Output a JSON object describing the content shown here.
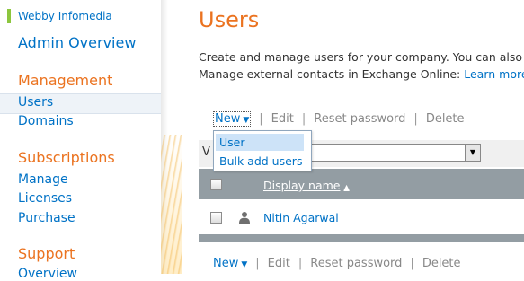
{
  "sidebar": {
    "brand": "Webby Infomedia",
    "admin_overview": "Admin Overview",
    "management": {
      "title": "Management",
      "items": [
        "Users",
        "Domains"
      ]
    },
    "subscriptions": {
      "title": "Subscriptions",
      "items": [
        "Manage",
        "Licenses",
        "Purchase"
      ]
    },
    "support": {
      "title": "Support",
      "items": [
        "Overview"
      ]
    }
  },
  "main": {
    "title": "Users",
    "description_line1": "Create and manage users for your company. You can also",
    "description_line2_prefix": "Manage external contacts in Exchange Online: ",
    "description_link": "Learn more",
    "toolbar": {
      "new_label": "New",
      "edit_label": "Edit",
      "reset_password_label": "Reset password",
      "delete_label": "Delete"
    },
    "new_menu": {
      "items": [
        "User",
        "Bulk add users"
      ],
      "highlighted": "User"
    },
    "view_label": "V",
    "table": {
      "column_header": "Display name",
      "sort": "ascending",
      "rows": [
        {
          "name": "Nitin Agarwal"
        }
      ]
    }
  },
  "colors": {
    "accent_orange": "#eb7320",
    "link_blue": "#0072c6",
    "brand_green": "#8cc63e",
    "table_header": "#939da3",
    "menu_highlight": "#cde3f8"
  },
  "icons": {
    "new_dropdown": "caret-down-icon",
    "sort": "sort-up-icon",
    "row_user": "person-icon",
    "select_arrow": "chevron-down-icon"
  }
}
